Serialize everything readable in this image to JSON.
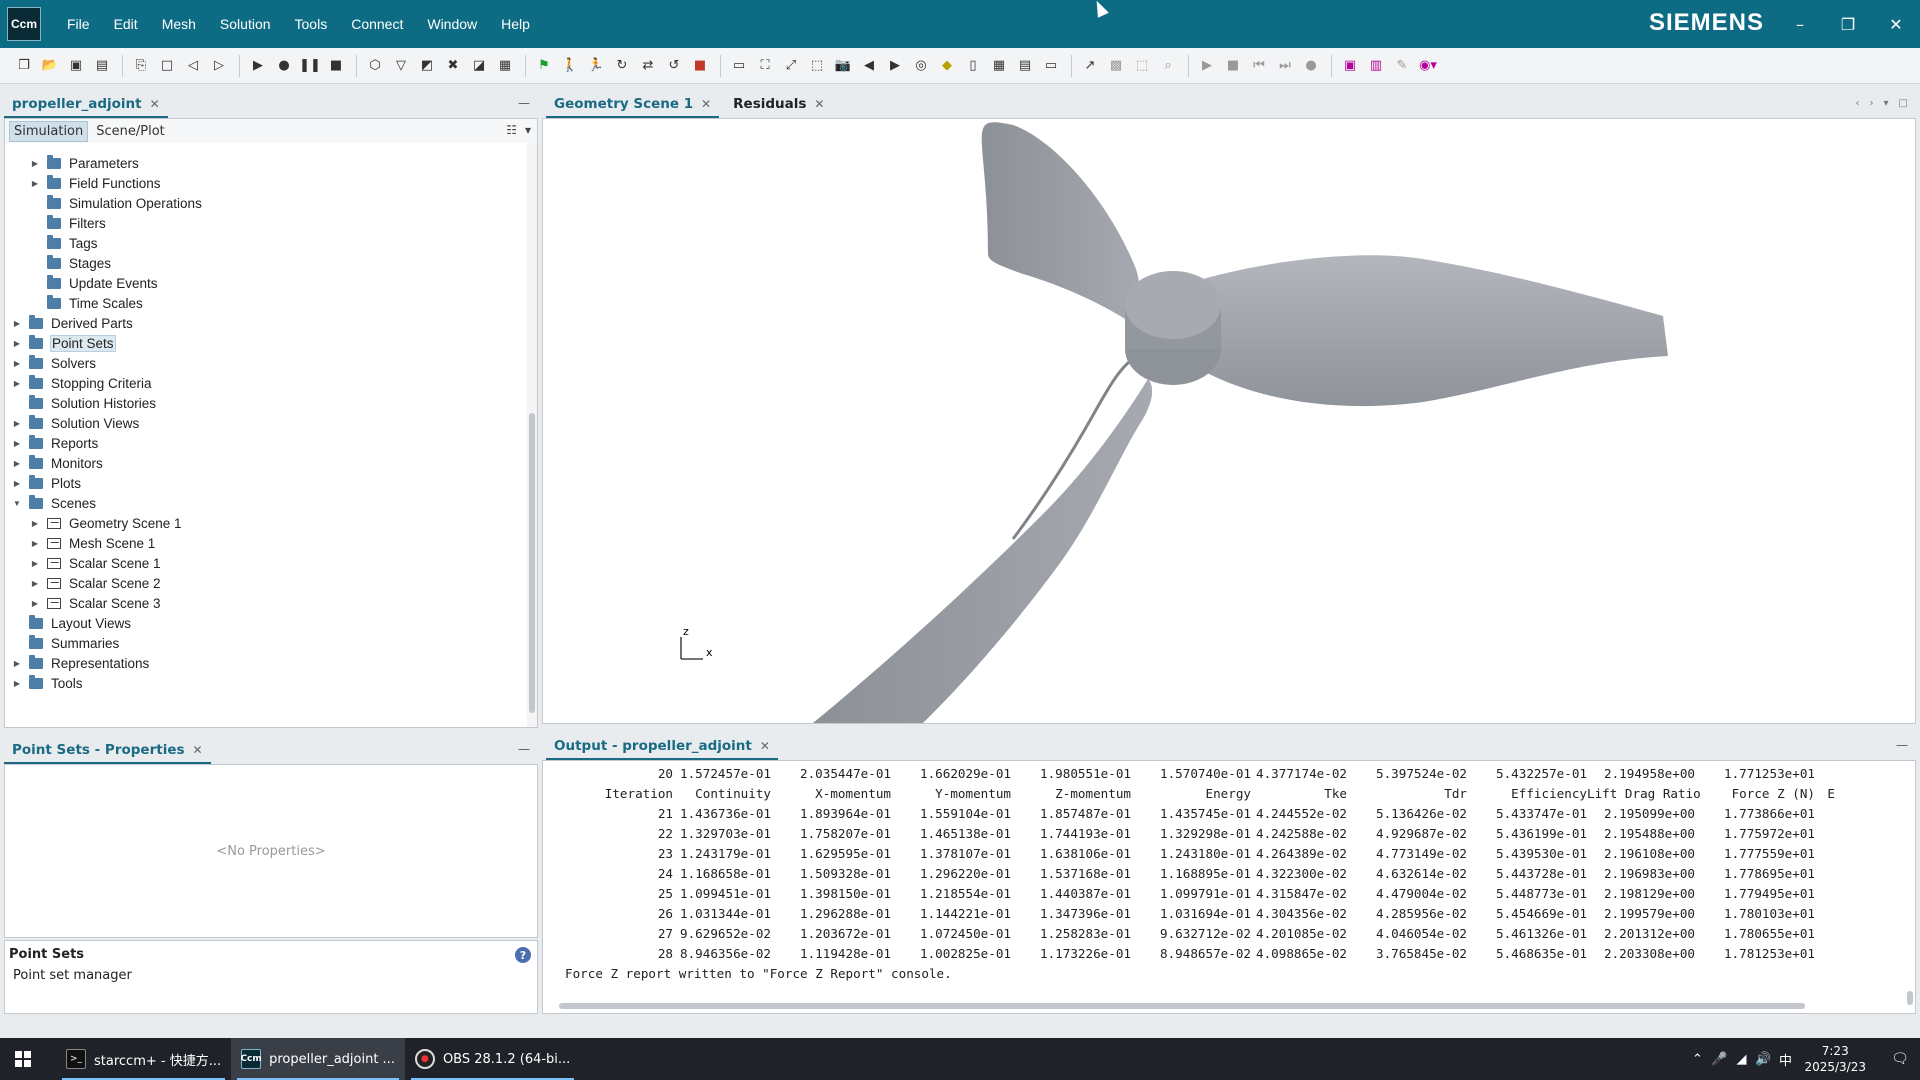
{
  "titlebar": {
    "logo_text": "Ccm",
    "menus": [
      "File",
      "Edit",
      "Mesh",
      "Solution",
      "Tools",
      "Connect",
      "Window",
      "Help"
    ],
    "brand": "SIEMENS"
  },
  "tree_panel": {
    "tab_label": "propeller_adjoint",
    "subtabs": [
      "Simulation",
      "Scene/Plot"
    ],
    "items": [
      {
        "label": "Parameters",
        "level": 1,
        "expander": "collapsed",
        "icon": "folder-icon"
      },
      {
        "label": "Field Functions",
        "level": 1,
        "expander": "collapsed",
        "icon": "folder-icon"
      },
      {
        "label": "Simulation Operations",
        "level": 1,
        "expander": "none",
        "icon": "folder-icon"
      },
      {
        "label": "Filters",
        "level": 1,
        "expander": "none",
        "icon": "folder-icon"
      },
      {
        "label": "Tags",
        "level": 1,
        "expander": "none",
        "icon": "folder-icon"
      },
      {
        "label": "Stages",
        "level": 1,
        "expander": "none",
        "icon": "folder-icon"
      },
      {
        "label": "Update Events",
        "level": 1,
        "expander": "none",
        "icon": "folder-icon"
      },
      {
        "label": "Time Scales",
        "level": 1,
        "expander": "none",
        "icon": "folder-icon"
      },
      {
        "label": "Derived Parts",
        "level": 0,
        "expander": "collapsed",
        "icon": "folder-icon"
      },
      {
        "label": "Point Sets",
        "level": 0,
        "expander": "collapsed",
        "icon": "folder-icon",
        "selected": true
      },
      {
        "label": "Solvers",
        "level": 0,
        "expander": "collapsed",
        "icon": "folder-icon"
      },
      {
        "label": "Stopping Criteria",
        "level": 0,
        "expander": "collapsed",
        "icon": "folder-icon"
      },
      {
        "label": "Solution Histories",
        "level": 0,
        "expander": "none",
        "icon": "folder-icon"
      },
      {
        "label": "Solution Views",
        "level": 0,
        "expander": "collapsed",
        "icon": "folder-icon"
      },
      {
        "label": "Reports",
        "level": 0,
        "expander": "collapsed",
        "icon": "folder-icon"
      },
      {
        "label": "Monitors",
        "level": 0,
        "expander": "collapsed",
        "icon": "folder-icon"
      },
      {
        "label": "Plots",
        "level": 0,
        "expander": "collapsed",
        "icon": "folder-icon"
      },
      {
        "label": "Scenes",
        "level": 0,
        "expander": "expanded",
        "icon": "folder-icon"
      },
      {
        "label": "Geometry Scene 1",
        "level": 1,
        "expander": "collapsed",
        "icon": "scene-icon"
      },
      {
        "label": "Mesh Scene 1",
        "level": 1,
        "expander": "collapsed",
        "icon": "scene-icon"
      },
      {
        "label": "Scalar Scene 1",
        "level": 1,
        "expander": "collapsed",
        "icon": "scene-icon"
      },
      {
        "label": "Scalar Scene 2",
        "level": 1,
        "expander": "collapsed",
        "icon": "scene-icon"
      },
      {
        "label": "Scalar Scene 3",
        "level": 1,
        "expander": "collapsed",
        "icon": "scene-icon"
      },
      {
        "label": "Layout Views",
        "level": 0,
        "expander": "none",
        "icon": "folder-icon"
      },
      {
        "label": "Summaries",
        "level": 0,
        "expander": "none",
        "icon": "folder-icon"
      },
      {
        "label": "Representations",
        "level": 0,
        "expander": "collapsed",
        "icon": "folder-icon"
      },
      {
        "label": "Tools",
        "level": 0,
        "expander": "collapsed",
        "icon": "folder-icon"
      }
    ]
  },
  "props_panel": {
    "tab_label": "Point Sets - Properties",
    "empty_text": "<No Properties>",
    "desc_title": "Point Sets",
    "desc_text": "Point set manager"
  },
  "scene_panel": {
    "tabs": [
      {
        "label": "Geometry Scene 1",
        "active": true
      },
      {
        "label": "Residuals",
        "active": false
      }
    ],
    "axis_labels": {
      "z": "z",
      "x": "x"
    },
    "blade_color": "#9ea2a9"
  },
  "output_panel": {
    "tab_label": "Output - propeller_adjoint",
    "first_row": [
      "20",
      "1.572457e-01",
      "2.035447e-01",
      "1.662029e-01",
      "1.980551e-01",
      "1.570740e-01",
      "4.377174e-02",
      "5.397524e-02",
      "5.432257e-01",
      "2.194958e+00",
      "1.771253e+01"
    ],
    "headers": [
      "Iteration",
      "Continuity",
      "X-momentum",
      "Y-momentum",
      "Z-momentum",
      "Energy",
      "Tke",
      "Tdr",
      "Efficiency",
      "Lift Drag Ratio",
      "Force Z (N)",
      "E"
    ],
    "rows": [
      [
        "21",
        "1.436736e-01",
        "1.893964e-01",
        "1.559104e-01",
        "1.857487e-01",
        "1.435745e-01",
        "4.244552e-02",
        "5.136426e-02",
        "5.433747e-01",
        "2.195099e+00",
        "1.773866e+01"
      ],
      [
        "22",
        "1.329703e-01",
        "1.758207e-01",
        "1.465138e-01",
        "1.744193e-01",
        "1.329298e-01",
        "4.242588e-02",
        "4.929687e-02",
        "5.436199e-01",
        "2.195488e+00",
        "1.775972e+01"
      ],
      [
        "23",
        "1.243179e-01",
        "1.629595e-01",
        "1.378107e-01",
        "1.638106e-01",
        "1.243180e-01",
        "4.264389e-02",
        "4.773149e-02",
        "5.439530e-01",
        "2.196108e+00",
        "1.777559e+01"
      ],
      [
        "24",
        "1.168658e-01",
        "1.509328e-01",
        "1.296220e-01",
        "1.537168e-01",
        "1.168895e-01",
        "4.322300e-02",
        "4.632614e-02",
        "5.443728e-01",
        "2.196983e+00",
        "1.778695e+01"
      ],
      [
        "25",
        "1.099451e-01",
        "1.398150e-01",
        "1.218554e-01",
        "1.440387e-01",
        "1.099791e-01",
        "4.315847e-02",
        "4.479004e-02",
        "5.448773e-01",
        "2.198129e+00",
        "1.779495e+01"
      ],
      [
        "26",
        "1.031344e-01",
        "1.296288e-01",
        "1.144221e-01",
        "1.347396e-01",
        "1.031694e-01",
        "4.304356e-02",
        "4.285956e-02",
        "5.454669e-01",
        "2.199579e+00",
        "1.780103e+01"
      ],
      [
        "27",
        "9.629652e-02",
        "1.203672e-01",
        "1.072450e-01",
        "1.258283e-01",
        "9.632712e-02",
        "4.201085e-02",
        "4.046054e-02",
        "5.461326e-01",
        "2.201312e+00",
        "1.780655e+01"
      ],
      [
        "28",
        "8.946356e-02",
        "1.119428e-01",
        "1.002825e-01",
        "1.173226e-01",
        "8.948657e-02",
        "4.098865e-02",
        "3.765845e-02",
        "5.468635e-01",
        "2.203308e+00",
        "1.781253e+01"
      ]
    ],
    "message": "Force Z report written to \"Force Z Report\" console."
  },
  "taskbar": {
    "tasks": [
      {
        "label": "starccm+ - 快捷方...",
        "icon": "terminal-icon",
        "active": false
      },
      {
        "label": "propeller_adjoint ...",
        "icon": "starccm-icon",
        "active": true
      },
      {
        "label": "OBS 28.1.2 (64-bi...",
        "icon": "obs-icon",
        "active": false
      }
    ],
    "ime": "中",
    "time": "7:23",
    "date": "2025/3/23"
  },
  "colors": {
    "titlebar": "#0e6b84",
    "accent": "#1a6a83",
    "taskbar": "#1f2228"
  }
}
